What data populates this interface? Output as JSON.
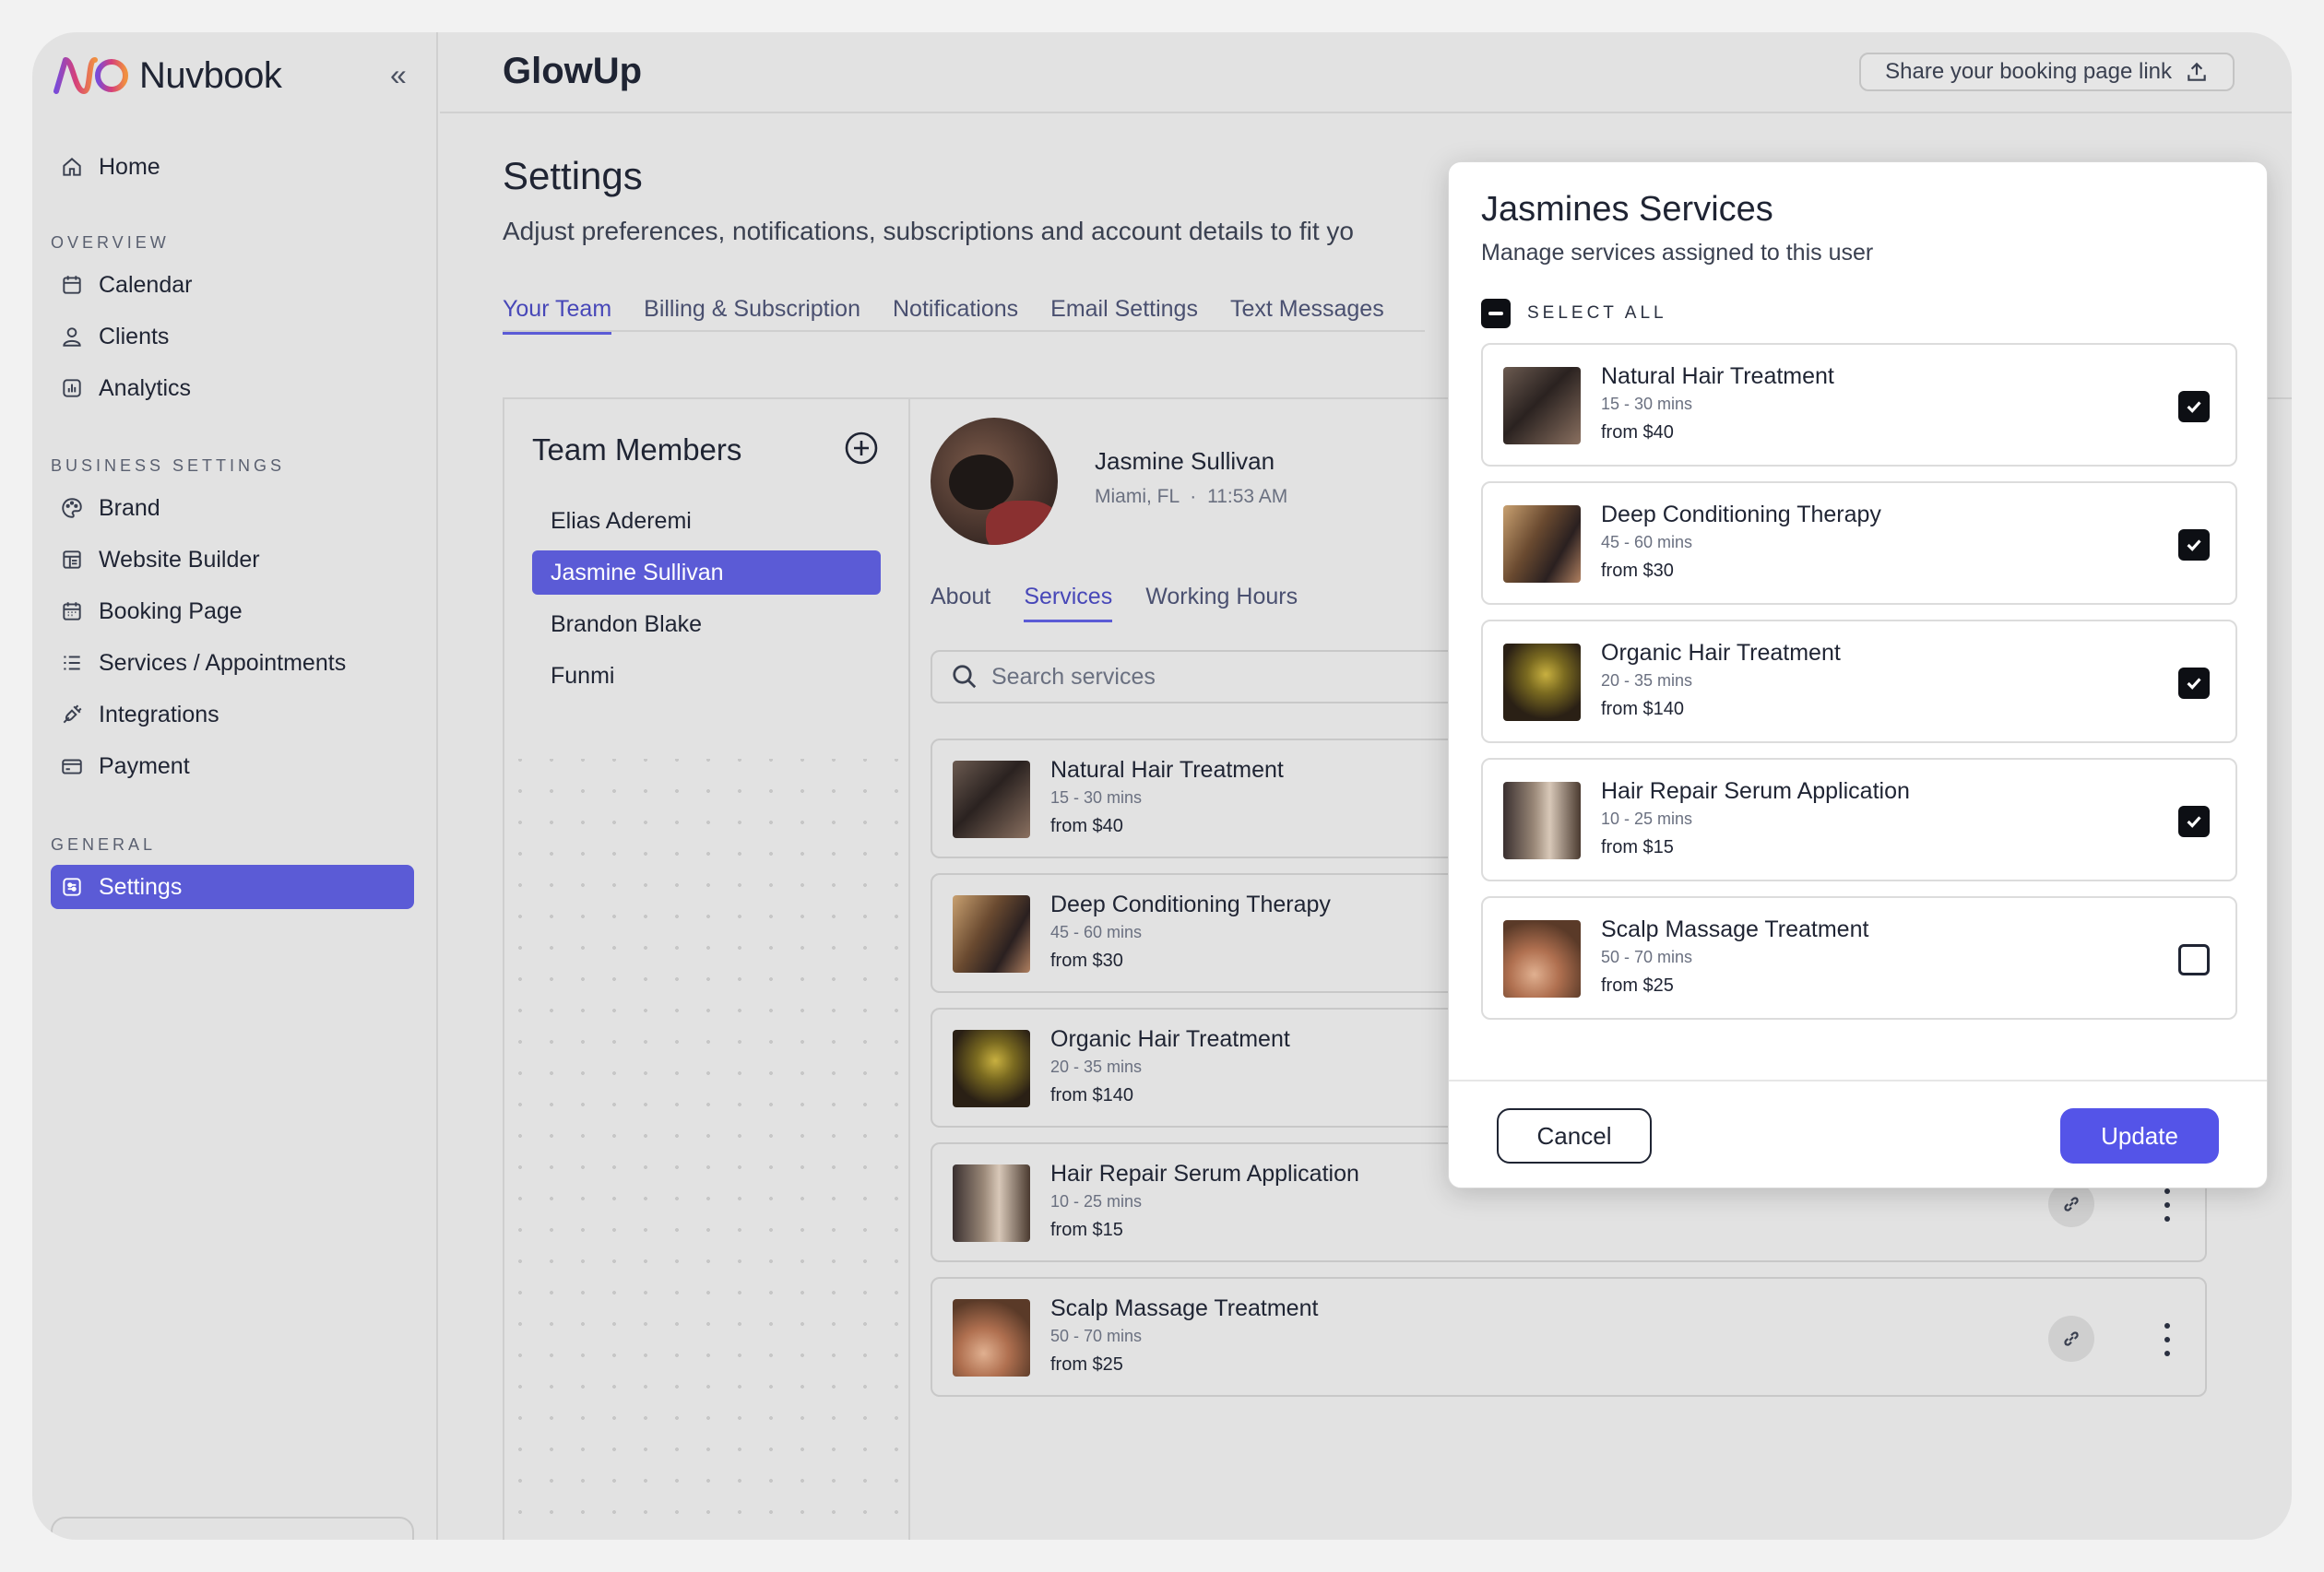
{
  "app": {
    "name": "Nuvbook",
    "collapse_label": "«"
  },
  "sidebar": {
    "items_top": [
      {
        "label": "Home",
        "icon": "home-icon"
      }
    ],
    "sections": [
      {
        "title": "OVERVIEW",
        "items": [
          {
            "label": "Calendar",
            "icon": "calendar-icon"
          },
          {
            "label": "Clients",
            "icon": "user-icon"
          },
          {
            "label": "Analytics",
            "icon": "analytics-icon"
          }
        ]
      },
      {
        "title": "BUSINESS SETTINGS",
        "items": [
          {
            "label": "Brand",
            "icon": "palette-icon"
          },
          {
            "label": "Website Builder",
            "icon": "layout-icon"
          },
          {
            "label": "Booking Page",
            "icon": "calendar-grid-icon"
          },
          {
            "label": "Services / Appointments",
            "icon": "list-icon"
          },
          {
            "label": "Integrations",
            "icon": "plug-icon"
          },
          {
            "label": "Payment",
            "icon": "card-icon"
          }
        ]
      },
      {
        "title": "GENERAL",
        "items": [
          {
            "label": "Settings",
            "icon": "settings-icon",
            "active": true
          }
        ]
      }
    ]
  },
  "header": {
    "business_name": "GlowUp",
    "share_label": "Share your booking page link"
  },
  "settings": {
    "title": "Settings",
    "subtitle": "Adjust preferences, notifications, subscriptions and account details to fit yo",
    "tabs": [
      "Your Team",
      "Billing & Subscription",
      "Notifications",
      "Email Settings",
      "Text Messages"
    ],
    "active_tab": "Your Team"
  },
  "team": {
    "title": "Team Members",
    "members": [
      "Elias Aderemi",
      "Jasmine Sullivan",
      "Brandon Blake",
      "Funmi"
    ],
    "selected": "Jasmine Sullivan"
  },
  "member": {
    "name": "Jasmine Sullivan",
    "location": "Miami,  FL",
    "separator": "·",
    "time": "11:53 AM",
    "tabs": [
      "About",
      "Services",
      "Working Hours"
    ],
    "active_tab": "Services",
    "search_placeholder": "Search services"
  },
  "services": [
    {
      "name": "Natural Hair Treatment",
      "duration": "15 - 30 mins",
      "price": "from $40",
      "assigned": true
    },
    {
      "name": "Deep Conditioning Therapy",
      "duration": "45 - 60 mins",
      "price": "from $30",
      "assigned": true
    },
    {
      "name": "Organic Hair Treatment",
      "duration": "20 - 35 mins",
      "price": "from $140",
      "assigned": true
    },
    {
      "name": "Hair Repair Serum Application",
      "duration": "10 - 25 mins",
      "price": "from $15",
      "assigned": true
    },
    {
      "name": "Scalp Massage Treatment",
      "duration": "50 - 70 mins",
      "price": "from $25",
      "assigned": false
    }
  ],
  "modal": {
    "title": "Jasmines Services",
    "subtitle": "Manage services assigned to this user",
    "select_all_label": "SELECT ALL",
    "cancel_label": "Cancel",
    "update_label": "Update"
  },
  "colors": {
    "accent": "#5b5bd6",
    "primary_button": "#5454e8",
    "checkbox": "#0d0f14"
  }
}
